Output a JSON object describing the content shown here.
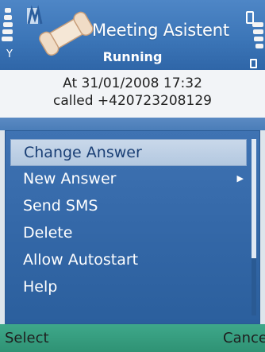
{
  "header": {
    "title": "Meeting Asistent",
    "status": "Running",
    "logo_icon": "phone-off-icon"
  },
  "info": {
    "line1": "At 31/01/2008 17:32",
    "line2": "called +420723208129"
  },
  "menu": {
    "items": [
      {
        "label": "Change Answer",
        "selected": true
      },
      {
        "label": "New Answer",
        "submenu": true
      },
      {
        "label": "Send SMS"
      },
      {
        "label": "Delete"
      },
      {
        "label": "Allow Autostart"
      },
      {
        "label": "Help"
      }
    ],
    "submenu_icon": "triangle-right-icon"
  },
  "softkeys": {
    "left": "Select",
    "right": "Cancel"
  },
  "colors": {
    "header_blue": "#3c76b8",
    "menu_blue": "#3468a8",
    "highlight": "#c9d8ea",
    "softkey_green": "#2f9274"
  }
}
